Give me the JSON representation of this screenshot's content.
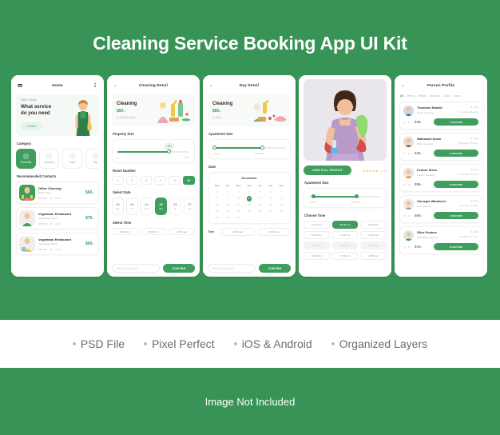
{
  "poster": {
    "title": "Cleaning Service Booking App UI Kit",
    "brand_green": "#389456",
    "accent_green": "#3f9e5d",
    "footer_note": "Image Not Included"
  },
  "features": [
    {
      "label": "PSD File"
    },
    {
      "label": "Pixel Perfect"
    },
    {
      "label": "iOS & Android"
    },
    {
      "label": "Organized Layers"
    }
  ],
  "screen1": {
    "nav": {
      "title": "Home",
      "menu_icon": "hamburger-menu-icon",
      "more_icon": "more-vertical-icon"
    },
    "hero": {
      "greeting": "Hello, Hillary",
      "headline_line1": "What service",
      "headline_line2": "do you need",
      "button": "Confirm"
    },
    "category_title": "Category",
    "categories": [
      {
        "label": "Generally",
        "icon": "home-icon",
        "active": true
      },
      {
        "label": "Cleaning",
        "icon": "mop-icon",
        "active": false
      },
      {
        "label": "Paint",
        "icon": "paint-roller-icon",
        "active": false
      },
      {
        "label": "Rep",
        "icon": "repair-icon",
        "active": false
      }
    ],
    "contacts_title": "Recommended Contacts",
    "contacts": [
      {
        "name": "Office Cleaning",
        "sub": "Hilary Duse",
        "off": "Off 12%",
        "rating": "(4.5)",
        "price": "$60",
        "unit": "/h"
      },
      {
        "name": "Vegetarian Restaurant",
        "sub": "Vegetarian Salad",
        "off": "Off 10%",
        "rating": "(4.7)",
        "price": "$75",
        "unit": "/h"
      },
      {
        "name": "Vegetarian Restaurant",
        "sub": "Vegetarian Salad",
        "off": "Off 12%",
        "rating": "(4.6)",
        "price": "$60",
        "unit": "/h"
      }
    ]
  },
  "screen2": {
    "nav": {
      "title": "Cleaning Detail",
      "back_icon": "arrow-left-icon"
    },
    "card": {
      "title": "Cleaning",
      "price": "$60",
      "unit": "/h",
      "rating": "(4.6) Reviews"
    },
    "property_title": "Property Size",
    "property": {
      "value": "750",
      "min": "0",
      "max": "1,000",
      "fill_pct": 72
    },
    "room_title": "Room Number",
    "rooms": [
      {
        "label": "1",
        "active": false
      },
      {
        "label": "2",
        "active": false
      },
      {
        "label": "3",
        "active": false
      },
      {
        "label": "4",
        "active": false
      },
      {
        "label": "5",
        "active": false
      },
      {
        "label": "6+",
        "active": true
      }
    ],
    "date_title": "Select Date",
    "dates": [
      {
        "num": "22",
        "dow": "Mon",
        "active": false
      },
      {
        "num": "23",
        "dow": "Tue",
        "active": false
      },
      {
        "num": "24",
        "dow": "Wed",
        "active": false
      },
      {
        "num": "25",
        "dow": "Thu",
        "active": true
      },
      {
        "num": "26",
        "dow": "Fri",
        "active": false
      },
      {
        "num": "27",
        "dow": "Sat",
        "active": false
      }
    ],
    "time_title": "Select Time",
    "times": [
      {
        "label": "07:00 am",
        "state": "idle"
      },
      {
        "label": "08:00 am",
        "state": "idle"
      },
      {
        "label": "09:00 am",
        "state": "idle"
      }
    ],
    "bottom": {
      "placeholder": "Enter Your Number",
      "button": "CONFIRM"
    }
  },
  "screen3": {
    "nav": {
      "title": "Day Detail",
      "back_icon": "arrow-left-icon"
    },
    "card": {
      "title": "Cleaning",
      "price": "$85",
      "unit": "/h",
      "rating": "(4.6)"
    },
    "apartment_title": "Apartment Size",
    "apartment": {
      "min_label": "0 sqft",
      "max_label": "894 sqft",
      "start_pct": 2,
      "end_pct": 68
    },
    "date_title": "Date",
    "calendar": {
      "month": "December",
      "prev_icon": "chevron-left-icon",
      "next_icon": "chevron-right-icon",
      "dow": [
        "Mon",
        "Tue",
        "Wed",
        "Thu",
        "Fri",
        "Sat",
        "Sun"
      ],
      "weeks": [
        [
          "1",
          "2",
          "3",
          "4",
          "5",
          "6",
          "7"
        ],
        [
          "8",
          "9",
          "10",
          "11",
          "12",
          "13",
          "14"
        ],
        [
          "15",
          "16",
          "17",
          "18",
          "19",
          "20",
          "21"
        ],
        [
          "22",
          "23",
          "24",
          "25",
          "26",
          "27",
          "28"
        ],
        [
          "29",
          "30",
          "31",
          "1",
          "2",
          "3",
          "4"
        ]
      ],
      "selected": "11",
      "dim_last_row_from": 3
    },
    "time_row": {
      "label": "Time",
      "slots": [
        {
          "label": "08:00 am",
          "state": "idle"
        },
        {
          "label": "20:00 pm",
          "state": "idle"
        }
      ]
    },
    "bottom": {
      "placeholder": "Enter Your Number",
      "button": "CONFIRM"
    }
  },
  "screen4": {
    "photo_alt": "cleaner-photo",
    "view_profile_button": "VIEW FULL PROFILE",
    "stars": "★★★★★",
    "rating": "(4.5)",
    "apartment_title": "Apartment Size",
    "apartment": {
      "min_label": "20 sqft",
      "max_label": "456 sqft",
      "start_pct": 6,
      "end_pct": 66
    },
    "choose_time_title": "Choose Time",
    "time_grid": [
      {
        "label": "07:00 am",
        "state": "idle"
      },
      {
        "label": "08:00 am",
        "state": "active"
      },
      {
        "label": "09:00 am",
        "state": "idle"
      },
      {
        "label": "10:00 am",
        "state": "idle"
      },
      {
        "label": "11:00 am",
        "state": "idle"
      },
      {
        "label": "12:00 pm",
        "state": "idle"
      },
      {
        "label": "13:00 pm",
        "state": "off"
      },
      {
        "label": "14:00 pm",
        "state": "off"
      },
      {
        "label": "15:00 pm",
        "state": "off"
      },
      {
        "label": "16:00 pm",
        "state": "idle"
      },
      {
        "label": "17:00 pm",
        "state": "idle"
      },
      {
        "label": "18:00 pm",
        "state": "idle"
      }
    ]
  },
  "screen5": {
    "nav": {
      "title": "Person Profile",
      "back_icon": "arrow-left-icon"
    },
    "filters": [
      {
        "label": "All",
        "active": true
      },
      {
        "label": "During",
        "active": false
      },
      {
        "label": "Detailed",
        "active": false
      },
      {
        "label": "Windows",
        "active": false
      },
      {
        "label": "Office",
        "active": false
      },
      {
        "label": "House",
        "active": false
      }
    ],
    "people": [
      {
        "name": "Theodore Handle",
        "job": "Home Cleaning",
        "rating": "(4.5)",
        "service": "Completion Service",
        "hours": "2h",
        "price": "$35",
        "unit": "/h",
        "button": "CONFIRM"
      },
      {
        "name": "Nathanael Down",
        "job": "Office Cleaning",
        "rating": "(4.4)",
        "service": "Completion Service",
        "hours": "3h",
        "price": "$45",
        "unit": "/h",
        "button": "CONFIRM"
      },
      {
        "name": "Pelican Steve",
        "job": "Garden Cleaning",
        "rating": "(4.7)",
        "service": "Completion Service",
        "hours": "2h",
        "price": "$55",
        "unit": "/h",
        "button": "CONFIRM"
      },
      {
        "name": "Carnegie Wandover",
        "job": "Car Cleaning",
        "rating": "(4.4)",
        "service": "Completion Service",
        "hours": "2h",
        "price": "$65",
        "unit": "/h",
        "button": "CONFIRM"
      },
      {
        "name": "Giles Posture",
        "job": "Wardrobe Cleaning",
        "rating": "(4.6)",
        "service": "Completion Service",
        "hours": "4h",
        "price": "$75",
        "unit": "/h",
        "button": "CONFIRM"
      }
    ]
  }
}
